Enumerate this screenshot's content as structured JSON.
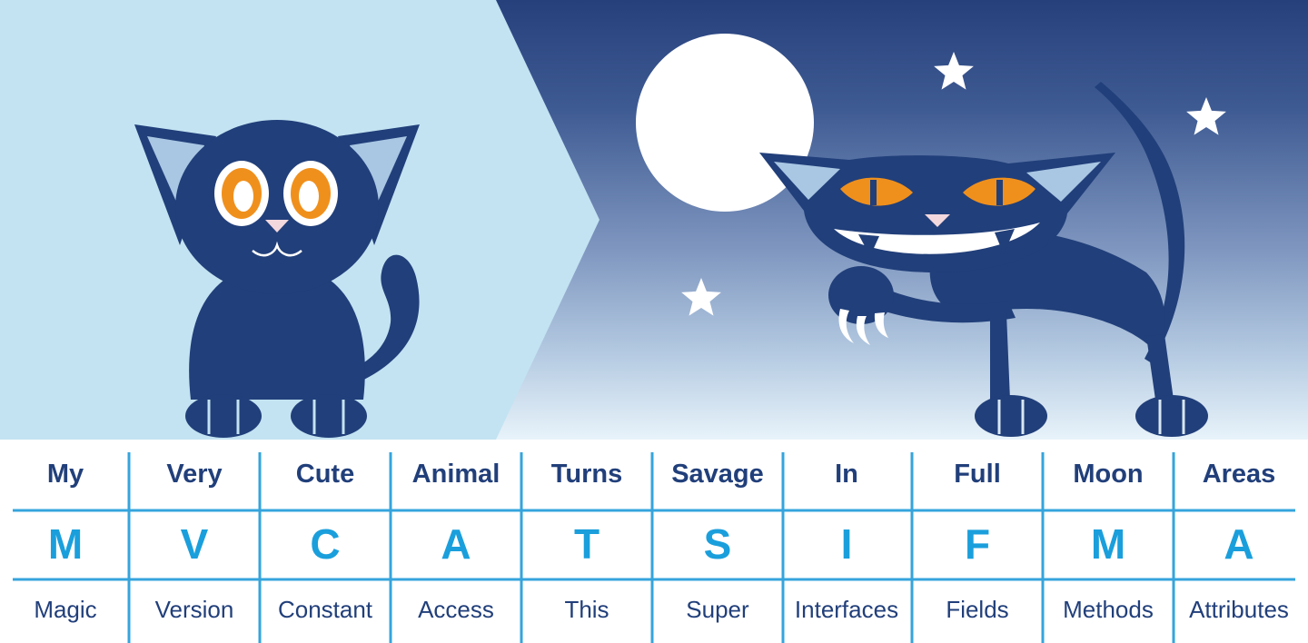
{
  "colors": {
    "navy": "#213f7a",
    "accent_blue": "#1a9fdc",
    "light_sky": "#c3e3f2",
    "eye_orange": "#f0901c",
    "moon": "#ffffff",
    "grid_line": "#35a4dc"
  },
  "mnemonic": [
    {
      "word": "My",
      "letter": "M",
      "meaning": "Magic"
    },
    {
      "word": "Very",
      "letter": "V",
      "meaning": "Version"
    },
    {
      "word": "Cute",
      "letter": "C",
      "meaning": "Constant"
    },
    {
      "word": "Animal",
      "letter": "A",
      "meaning": "Access"
    },
    {
      "word": "Turns",
      "letter": "T",
      "meaning": "This"
    },
    {
      "word": "Savage",
      "letter": "S",
      "meaning": "Super"
    },
    {
      "word": "In",
      "letter": "I",
      "meaning": "Interfaces"
    },
    {
      "word": "Full",
      "letter": "F",
      "meaning": "Fields"
    },
    {
      "word": "Moon",
      "letter": "M",
      "meaning": "Methods"
    },
    {
      "word": "Areas",
      "letter": "A",
      "meaning": "Attributes"
    }
  ]
}
